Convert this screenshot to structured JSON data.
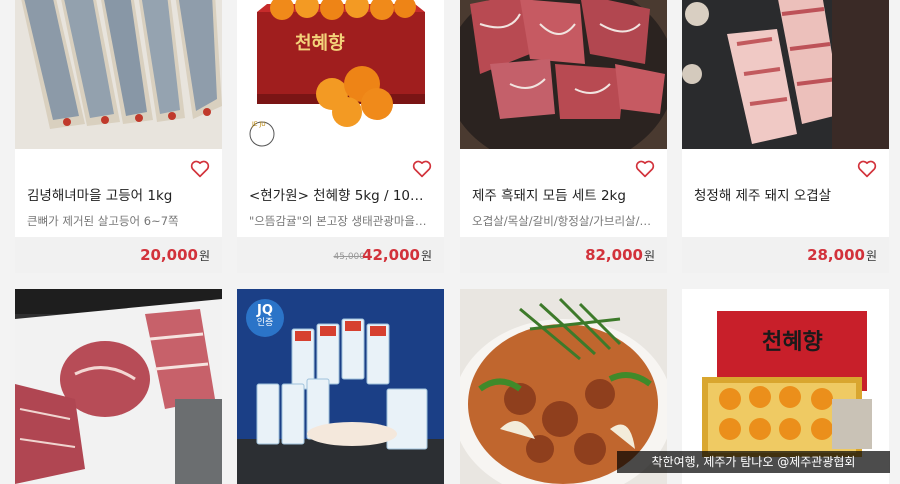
{
  "products": [
    {
      "title": "김녕해녀마을 고등어 1kg",
      "desc": "큰뼈가 제거된 살고등어 6~7쪽",
      "price": "20,000",
      "orig": "",
      "image_alt": "mackerel-fillets"
    },
    {
      "title": "<현가원> 천혜향 5kg / 10kg (…",
      "desc": "\"으뜸감귤\"의 본고장 생태관광마을 하…",
      "price": "42,000",
      "orig": "45,000",
      "image_alt": "cheonhyehyang-box",
      "box_label": "천혜향",
      "brand_logo_text": "JE JU"
    },
    {
      "title": "제주 흑돼지 모듬 세트 2kg",
      "desc": "오겹살/목살/갈비/항정살/가브리살/…",
      "price": "82,000",
      "orig": "",
      "image_alt": "black-pork-set"
    },
    {
      "title": "청정해 제주 돼지 오겹살",
      "desc": "",
      "price": "28,000",
      "orig": "",
      "image_alt": "pork-belly"
    },
    {
      "image_alt": "raw-pork-cuts"
    },
    {
      "image_alt": "dried-fish-packages",
      "badge_top": "JQ",
      "badge_bottom": "인증"
    },
    {
      "image_alt": "spicy-pork-stirfry"
    },
    {
      "image_alt": "cheonhyehyang-giftbox",
      "box_label": "천혜향"
    }
  ],
  "currency": "원",
  "watermark": "착한여행, 제주가 탐나오 @제주관광협회",
  "colors": {
    "accent": "#d2323b",
    "heart": "#d2323b",
    "badge": "#2b74c8"
  },
  "icons": {
    "wishlist": "heart-outline-icon"
  }
}
